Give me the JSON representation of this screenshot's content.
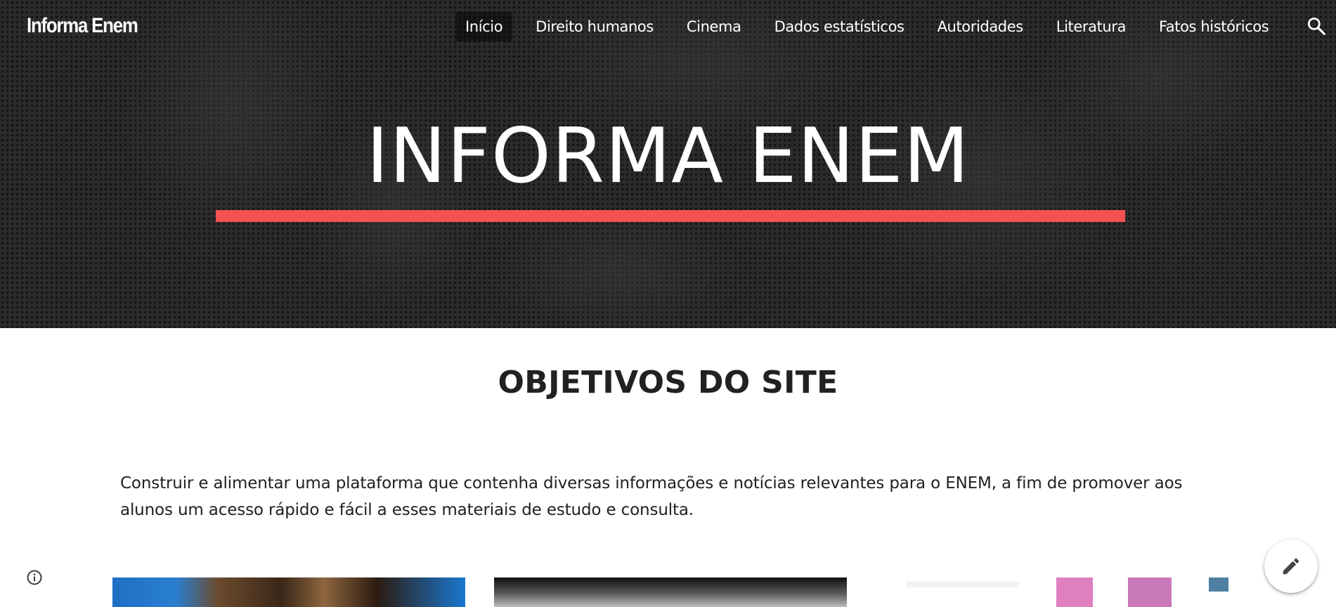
{
  "header": {
    "site_title": "Informa Enem",
    "nav": [
      {
        "label": "Início",
        "active": true
      },
      {
        "label": "Direito humanos",
        "active": false
      },
      {
        "label": "Cinema",
        "active": false
      },
      {
        "label": "Dados estatísticos",
        "active": false
      },
      {
        "label": "Autoridades",
        "active": false
      },
      {
        "label": "Literatura",
        "active": false
      },
      {
        "label": "Fatos históricos",
        "active": false
      }
    ],
    "search_icon": "search-icon"
  },
  "hero": {
    "title": "INFORMA ENEM",
    "accent_color": "#f25252",
    "background_color": "#2b2b2b"
  },
  "main": {
    "section_heading": "OBJETIVOS DO SITE",
    "paragraph": "Construir e alimentar uma plataforma que contenha diversas informações e notícias relevantes para o ENEM, a fim de promover aos alunos um acesso rápido e fácil a esses materiais de estudo e consulta."
  },
  "footer_controls": {
    "info_icon": "info-icon",
    "edit_icon": "pencil-icon"
  }
}
